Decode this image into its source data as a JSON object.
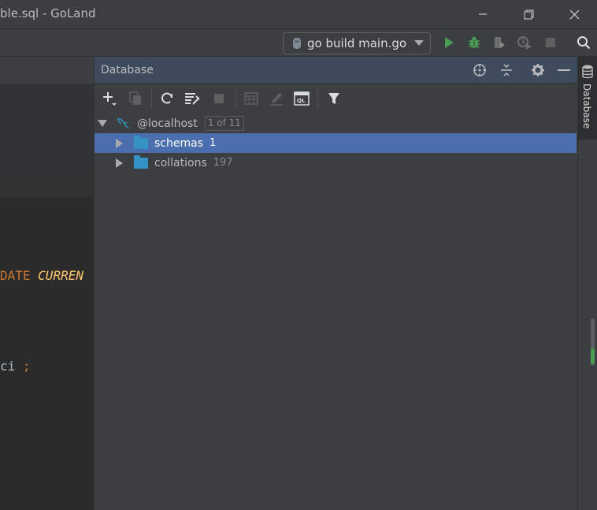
{
  "window": {
    "title": "ble.sql - GoLand",
    "minimize_icon": "minimize-icon",
    "maximize_icon": "restore-icon",
    "close_icon": "close-icon"
  },
  "toolbar": {
    "run_config_label": "go build main.go",
    "icons": [
      "run-icon",
      "debug-icon",
      "coverage-icon",
      "profile-icon",
      "stop-icon",
      "search-icon"
    ]
  },
  "editor": {
    "line_1_keyword": "DATE",
    "line_1_function": "CURREN",
    "line_2_text": "ci",
    "line_2_semicolon": ";"
  },
  "database": {
    "title": "Database",
    "header_icons": [
      "locate-icon",
      "collapse-all-icon",
      "settings-icon",
      "hide-icon"
    ],
    "toolbar_icons": [
      "add-icon",
      "duplicate-icon",
      "refresh-icon",
      "schema-settings-icon",
      "stop-icon",
      "table-icon",
      "edit-icon",
      "console-icon",
      "filter-icon"
    ],
    "tree": {
      "host": {
        "label": "@localhost",
        "badge": "1 of 11"
      },
      "items": [
        {
          "label": "schemas",
          "count": "1"
        },
        {
          "label": "collations",
          "count": "197"
        }
      ]
    }
  },
  "right_stripe": {
    "tab_label": "Database"
  },
  "colors": {
    "selection": "#4b6eaf",
    "folder": "#3592c4",
    "run_green": "#499c54",
    "keyword_orange": "#cc7832",
    "function_yellow": "#ffc66d"
  }
}
